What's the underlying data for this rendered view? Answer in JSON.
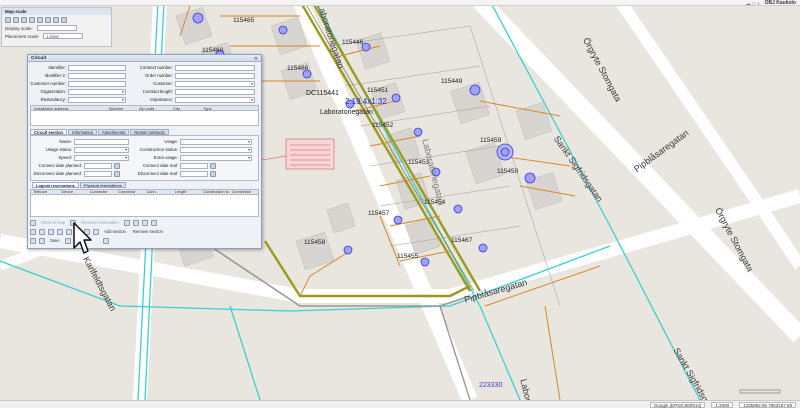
{
  "app": {
    "brand": "OBJ Kaukolo"
  },
  "map_scale": {
    "title": "Map scale",
    "display_scale_label": "Display scale:",
    "placement_scale_label": "Placement scale:",
    "placement_scale_value": "1:2000"
  },
  "dialog": {
    "title": "Circuit",
    "fields_left": [
      {
        "label": "Identifier:"
      },
      {
        "label": "Identifier 2:"
      },
      {
        "label": "Customer number:"
      },
      {
        "label": "Organization:"
      },
      {
        "label": "Redundancy:"
      }
    ],
    "fields_right": [
      {
        "label": "Contract number:"
      },
      {
        "label": "Order number:"
      },
      {
        "label": "Customer:"
      },
      {
        "label": "Contract length:"
      },
      {
        "label": "Importance:"
      }
    ],
    "address_table": {
      "columns": [
        "Installation address",
        "Number",
        "Zip code",
        "City",
        "Type"
      ]
    },
    "tabs": [
      "Circuit section",
      "Information",
      "Attachments",
      "Rental contracts"
    ],
    "section_fields_left": [
      {
        "label": "Name:"
      },
      {
        "label": "Usage status:"
      },
      {
        "label": "Speed:"
      },
      {
        "label": "Connect date planned:"
      },
      {
        "label": "Disconnect date planned:"
      }
    ],
    "section_fields_right": [
      {
        "label": "Usage:"
      },
      {
        "label": "Construction status:"
      },
      {
        "label": "Extra usage:"
      },
      {
        "label": "Connect date real:"
      },
      {
        "label": "Disconnect date real:"
      }
    ],
    "res_tabs": [
      "Logical reservations",
      "Physical reservations"
    ],
    "res_columns": [
      "Telecom premises",
      "Device",
      "Connector",
      "Connector",
      "Conn.",
      "Length",
      "Construction st.",
      "Connection det."
    ],
    "buttons_row1": [
      "Show in map",
      "Remove reservation"
    ],
    "buttons_row2": [
      "Add section",
      "Remove section"
    ],
    "buttons_row3": [
      "Save"
    ]
  },
  "map": {
    "parcels": [
      {
        "id": "115465"
      },
      {
        "id": "115460"
      },
      {
        "id": "115446"
      },
      {
        "id": "115466"
      },
      {
        "id": "115451"
      },
      {
        "id": "115449"
      },
      {
        "id": "115452"
      },
      {
        "id": "115459"
      },
      {
        "id": "115453"
      },
      {
        "id": "115450"
      },
      {
        "id": "115454"
      },
      {
        "id": "115457"
      },
      {
        "id": "115467"
      },
      {
        "id": "115458"
      },
      {
        "id": "115455"
      }
    ],
    "dc_label": "DC115441",
    "street_lab_small": "Laboratoriegatan",
    "scale_overlay": "2:19.4x1:32",
    "streets": {
      "orgryte_stomgata_top": "Örgryte Stomgata",
      "sankt_sigfridsgatan": "Sankt Sigfridsgatan",
      "pipblasaregatan_right": "Pipblåsaregatan",
      "orgryte_stomgata_right": "Örgryte Stomgata",
      "laboratoriegatan": "Laboratoriegatan",
      "pipblasaregatan": "Pipblåsaregatan",
      "karlfeldtsgatan": "Karlfeldtsgatan",
      "laboratoriegatan_top": "Laboratoriegatan",
      "sankt_sigfrid_bottom": "Sankt Sigfridsgatan",
      "laboratorie_bottom": "Laborat"
    },
    "footer_number": "223330"
  },
  "status": {
    "coords": "1335992.95 7963187.59",
    "zoom": "1:2000",
    "mode": "Google (EPSG:900913)"
  },
  "colors": {
    "cable_olive": "#9a9a1e",
    "cable_cyan": "#3cd0d0",
    "cable_orange": "#d4882a",
    "road_white": "#ffffff"
  }
}
